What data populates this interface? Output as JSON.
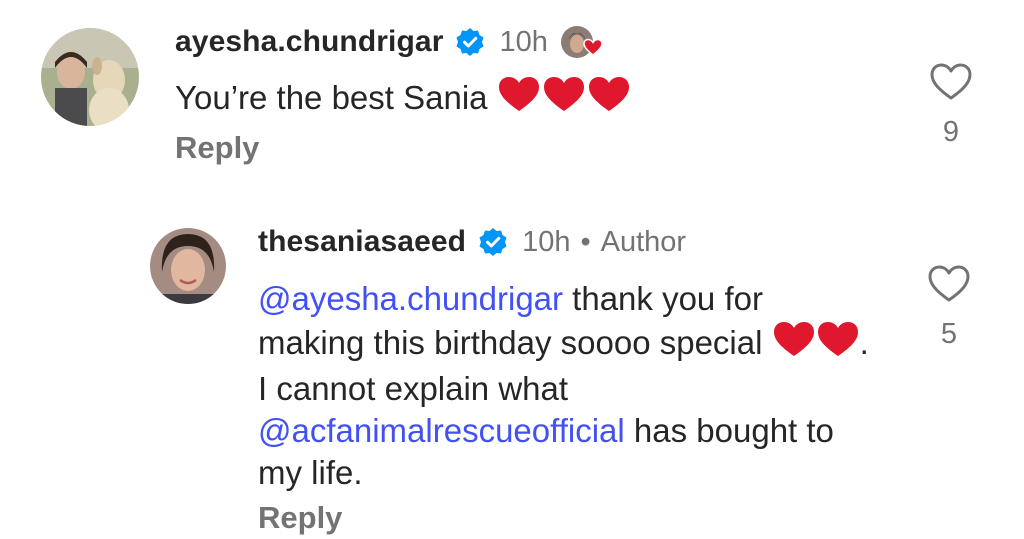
{
  "comments": [
    {
      "username": "ayesha.chundrigar",
      "time": "10h",
      "text": "You’re the best Sania",
      "reply_label": "Reply",
      "like_count": "9",
      "emoji_hearts": 3
    },
    {
      "username": "thesaniasaeed",
      "time": "10h",
      "separator": "•",
      "author_label": "Author",
      "mention_1": "@ayesha.chundrigar",
      "text_1": " thank you for making this birthday soooo special ",
      "text_2": ". I cannot explain what ",
      "mention_2": "@acfanimalrescueofficial",
      "text_3": "  has bought to my life.",
      "reply_label": "Reply",
      "like_count": "5",
      "emoji_hearts": 2
    }
  ],
  "colors": {
    "mention": "#4150f7",
    "verified": "#0095f6",
    "heart": "#e0182d",
    "secondary_text": "#737373",
    "primary_text": "#262626"
  },
  "icons": {
    "verified": "verified-badge-icon",
    "like": "heart-outline-icon",
    "liked_by_author": "author-liked-heart-icon"
  }
}
